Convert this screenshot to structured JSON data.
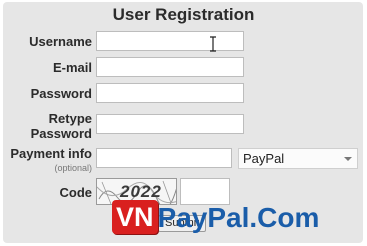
{
  "form": {
    "title": "User Registration",
    "fields": {
      "username_label": "Username",
      "email_label": "E-mail",
      "password_label": "Password",
      "retype_label_line1": "Retype",
      "retype_label_line2": "Password",
      "payment_label": "Payment info",
      "payment_sublabel": "(optional)",
      "code_label": "Code"
    },
    "payment_method_selected": "PayPal",
    "captcha_text": "2022",
    "submit_label": "Submit"
  },
  "watermark": {
    "brand_left": "VN",
    "brand_right": "PayPal.Com",
    "colors": {
      "vn_bg": "#d9201f",
      "text_blue": "#1a5da9"
    }
  },
  "icons": {
    "text_cursor": "i-beam-cursor-icon",
    "dropdown": "chevron-down-icon"
  }
}
